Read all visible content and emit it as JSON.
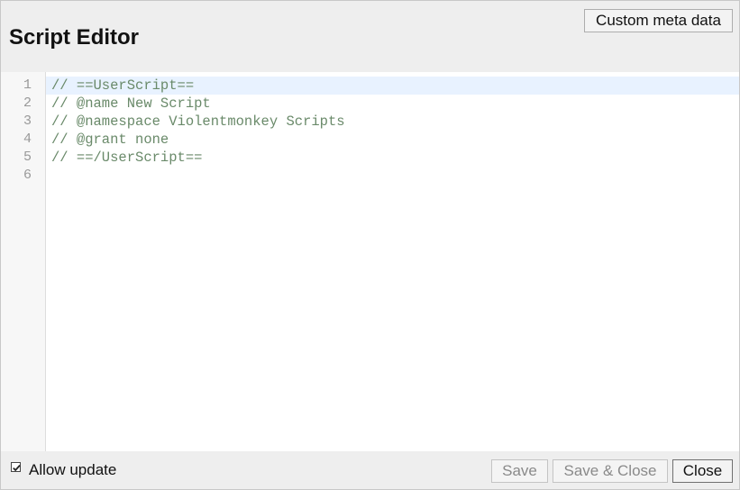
{
  "header": {
    "title": "Script Editor",
    "meta_button_label": "Custom meta data"
  },
  "editor": {
    "line_numbers": [
      "1",
      "2",
      "3",
      "4",
      "5",
      "6"
    ],
    "lines": [
      "// ==UserScript==",
      "// @name New Script",
      "// @namespace Violentmonkey Scripts",
      "// @grant none",
      "// ==/UserScript==",
      ""
    ],
    "active_line": 1
  },
  "footer": {
    "allow_update_label": "Allow update",
    "allow_update_checked": true,
    "save_label": "Save",
    "save_close_label": "Save & Close",
    "close_label": "Close"
  },
  "colors": {
    "comment_text": "#6a8a6a",
    "active_line_bg": "#e8f2ff",
    "chrome_bg": "#eeeeee"
  }
}
